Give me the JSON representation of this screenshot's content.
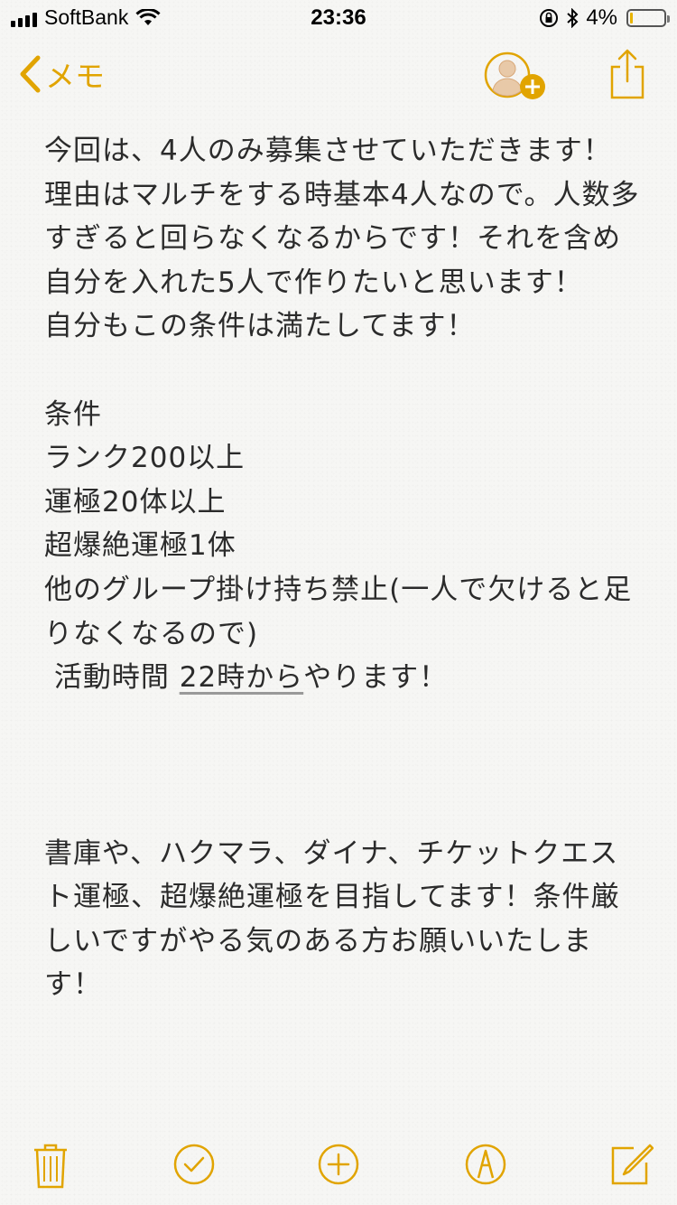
{
  "status": {
    "carrier": "SoftBank",
    "time": "23:36",
    "battery": "4%",
    "battery_level": 0.04
  },
  "nav": {
    "back_label": "メモ",
    "icons": [
      "chevron-left-icon",
      "add-person-icon",
      "share-icon"
    ]
  },
  "note": {
    "para1": "今回は、4人のみ募集させていただきます！\n理由はマルチをする時基本4人なので。人数多すぎると回らなくなるからです！それを含め自分を入れた5人で作りたいと思います！\n自分もこの条件は満たしてます！",
    "conditions_title": "条件",
    "cond1": "ランク200以上",
    "cond2": "運極20体以上",
    "cond3": "超爆絶運極1体",
    "cond4": "他のグループ掛け持ち禁止(一人で欠けると足りなくなるので)",
    "activity_prefix": " 活動時間 ",
    "activity_time": "22時から",
    "activity_suffix": "やります！",
    "para2": "書庫や、ハクマラ、ダイナ、チケットクエスト運極、超爆絶運極を目指してます！条件厳しいですがやる気のある方お願いいたします！"
  },
  "toolbar": {
    "icons": [
      "trash-icon",
      "checklist-icon",
      "add-icon",
      "markup-icon",
      "compose-icon"
    ]
  },
  "colors": {
    "accent": "#e1a400",
    "text": "#2b2b2b",
    "background": "#f6f6f4"
  }
}
